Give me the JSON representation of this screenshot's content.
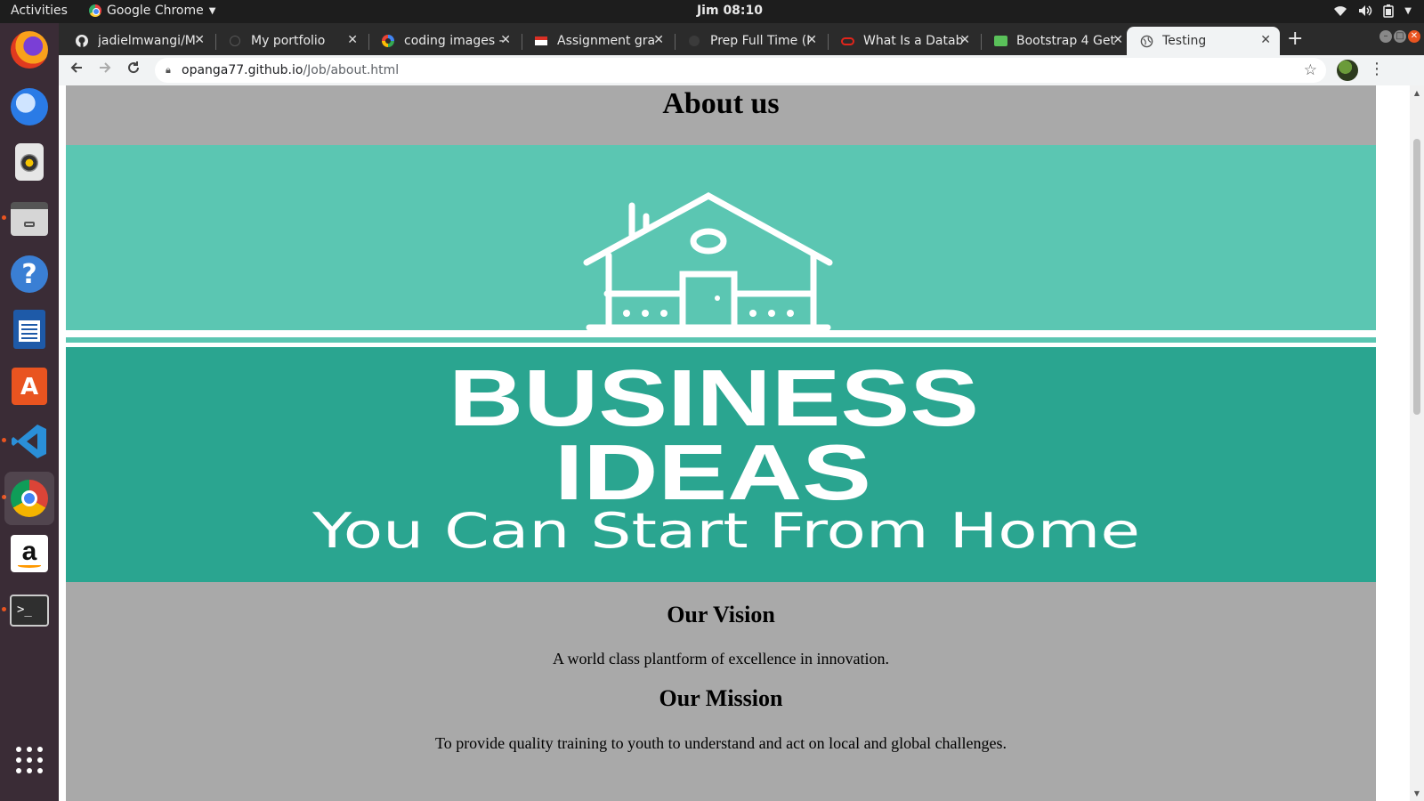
{
  "topbar": {
    "activities": "Activities",
    "app_name": "Google Chrome",
    "clock": "Jim 08:10"
  },
  "dock": {
    "apps": [
      "Firefox",
      "Thunderbird",
      "Rhythmbox",
      "Files",
      "Help",
      "LibreOffice Writer",
      "Ubuntu Software",
      "Visual Studio Code",
      "Google Chrome",
      "Amazon",
      "Terminal",
      "Show Applications"
    ]
  },
  "browser": {
    "tabs": [
      {
        "title": "jadielmwangi/M",
        "favicon": "github-icon"
      },
      {
        "title": "My portfolio",
        "favicon": "blank-page-icon"
      },
      {
        "title": "coding images -",
        "favicon": "google-icon"
      },
      {
        "title": "Assignment gra",
        "favicon": "gmail-icon"
      },
      {
        "title": "Prep Full Time (I",
        "favicon": "moringa-icon"
      },
      {
        "title": "What Is a Datab",
        "favicon": "oracle-icon"
      },
      {
        "title": "Bootstrap 4 Get",
        "favicon": "bootstrap-icon"
      },
      {
        "title": "Testing",
        "favicon": "globe-icon",
        "active": true
      }
    ],
    "new_tab": "+",
    "url_host": "opanga77.github.io",
    "url_path": "/Job/about.html"
  },
  "page": {
    "title": "About us",
    "banner": {
      "line1": "BUSINESS",
      "line2": "IDEAS",
      "line3": "You Can Start From Home",
      "colors": {
        "top": "#5bc6b2",
        "bottom": "#2aa590",
        "ink": "#ffffff"
      }
    },
    "vision_heading": "Our Vision",
    "vision_text": "A world class plantform of excellence in innovation.",
    "mission_heading": "Our Mission",
    "mission_text": "To provide quality training to youth to understand and act on local and global challenges."
  }
}
